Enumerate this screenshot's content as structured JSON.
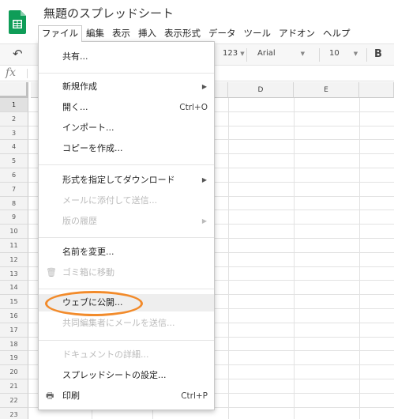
{
  "app": {
    "title": "無題のスプレッドシート",
    "brand_color": "#0f9d58"
  },
  "menubar": {
    "items": [
      "ファイル",
      "編集",
      "表示",
      "挿入",
      "表示形式",
      "データ",
      "ツール",
      "アドオン",
      "ヘルプ"
    ],
    "active_index": 0
  },
  "toolbar": {
    "undo_icon": "undo-icon",
    "number_format": "123",
    "font": "Arial",
    "font_size": "10",
    "bold": "B"
  },
  "formula_bar": {
    "fx_label": "fx"
  },
  "grid": {
    "columns": [
      "D",
      "E"
    ],
    "rows": [
      "1",
      "2",
      "3",
      "4",
      "5",
      "6",
      "7",
      "8",
      "9",
      "10",
      "11",
      "12",
      "13",
      "14",
      "15",
      "16",
      "17",
      "18",
      "19",
      "20",
      "21",
      "22",
      "23"
    ],
    "selected_row": "1"
  },
  "file_menu": {
    "share": "共有...",
    "new": "新規作成",
    "open": "開く...",
    "open_shortcut": "Ctrl+O",
    "import": "インポート...",
    "make_copy": "コピーを作成...",
    "download_as": "形式を指定してダウンロード",
    "email_attachment": "メールに添付して送信...",
    "version_history": "版の履歴",
    "rename": "名前を変更...",
    "move_to_trash": "ゴミ箱に移動",
    "publish_to_web": "ウェブに公開...",
    "email_collaborators": "共同編集者にメールを送信...",
    "document_details": "ドキュメントの詳細...",
    "spreadsheet_settings": "スプレッドシートの設定...",
    "print": "印刷",
    "print_shortcut": "Ctrl+P"
  },
  "annotation": {
    "ring_color": "#f28b2b",
    "target": "publish_to_web"
  }
}
